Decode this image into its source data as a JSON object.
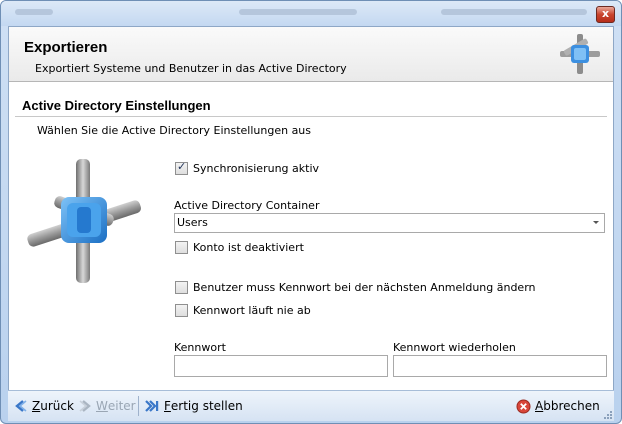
{
  "window": {
    "close_glyph": "x"
  },
  "header": {
    "title": "Exportieren",
    "subtitle": "Exportiert Systeme und Benutzer in das Active Directory",
    "icon": "active-directory-icon"
  },
  "section": {
    "title": "Active Directory Einstellungen",
    "subtitle": "Wählen Sie die Active Directory Einstellungen aus"
  },
  "form": {
    "sync": {
      "label": "Synchronisierung aktiv",
      "checked": true
    },
    "container": {
      "label": "Active Directory Container",
      "value": "Users"
    },
    "disabled_account": {
      "label": "Konto ist deaktiviert",
      "checked": false
    },
    "change_password": {
      "label": "Benutzer muss Kennwort bei der nächsten Anmeldung ändern",
      "checked": false
    },
    "never_expires": {
      "label": "Kennwort läuft nie ab",
      "checked": false
    },
    "password": {
      "label": "Kennwort",
      "value": ""
    },
    "password_repeat": {
      "label": "Kennwort wiederholen",
      "value": ""
    }
  },
  "footer": {
    "back": {
      "prefix": "",
      "accel": "Z",
      "rest": "urück"
    },
    "next": {
      "prefix": "",
      "accel": "W",
      "rest": "eiter"
    },
    "finish": {
      "prefix": "",
      "accel": "F",
      "rest": "ertig stellen"
    },
    "cancel": {
      "prefix": "",
      "accel": "A",
      "rest": "bbrechen"
    }
  },
  "colors": {
    "accent": "#3c8fe0",
    "titlebar": "#c4d8f1",
    "close": "#c9452f"
  }
}
